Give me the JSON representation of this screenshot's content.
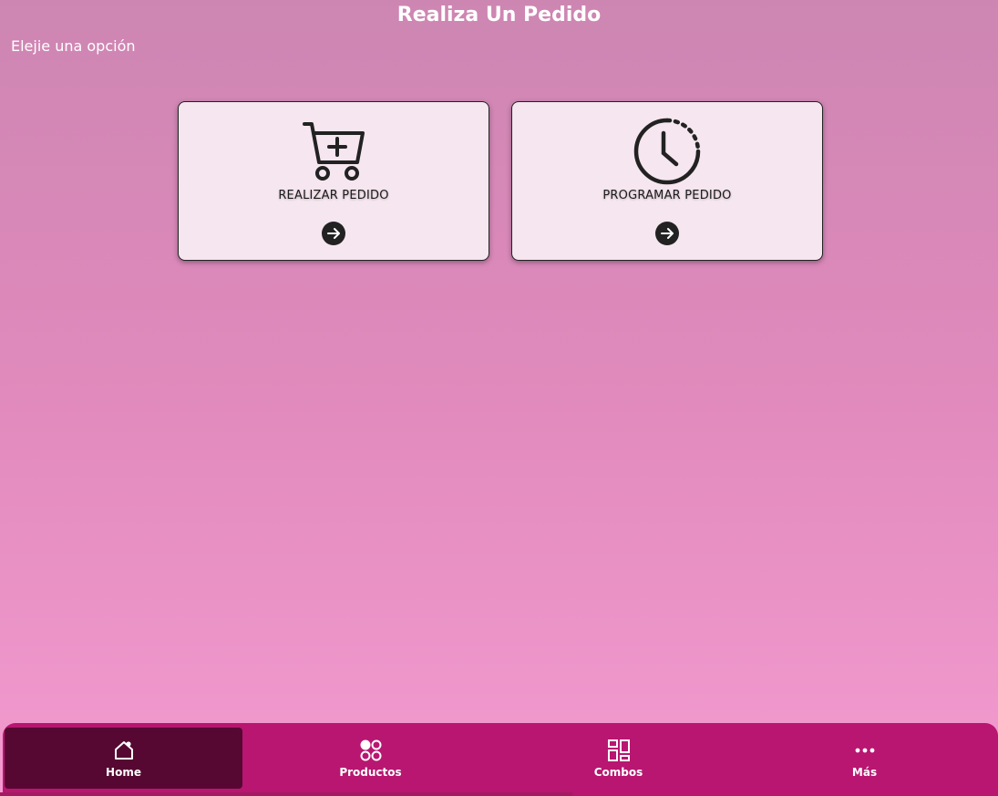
{
  "header": {
    "title": "Realiza Un Pedido",
    "subtitle": "Elejie una opción"
  },
  "cards": [
    {
      "label": "REALIZAR PEDIDO",
      "icon": "cart-plus-icon"
    },
    {
      "label": "PROGRAMAR PEDIDO",
      "icon": "clock-schedule-icon"
    }
  ],
  "bottom_nav": {
    "items": [
      {
        "label": "Home",
        "icon": "home-icon",
        "active": true
      },
      {
        "label": "Productos",
        "icon": "products-grid-icon",
        "active": false
      },
      {
        "label": "Combos",
        "icon": "combos-layout-icon",
        "active": false
      },
      {
        "label": "Más",
        "icon": "more-dots-icon",
        "active": false
      }
    ]
  },
  "colors": {
    "background_top": "#cd86b2",
    "background_bottom": "#f39bd0",
    "card_background": "#f6e6ef",
    "nav_background": "#b81671",
    "nav_active": "#560832"
  }
}
